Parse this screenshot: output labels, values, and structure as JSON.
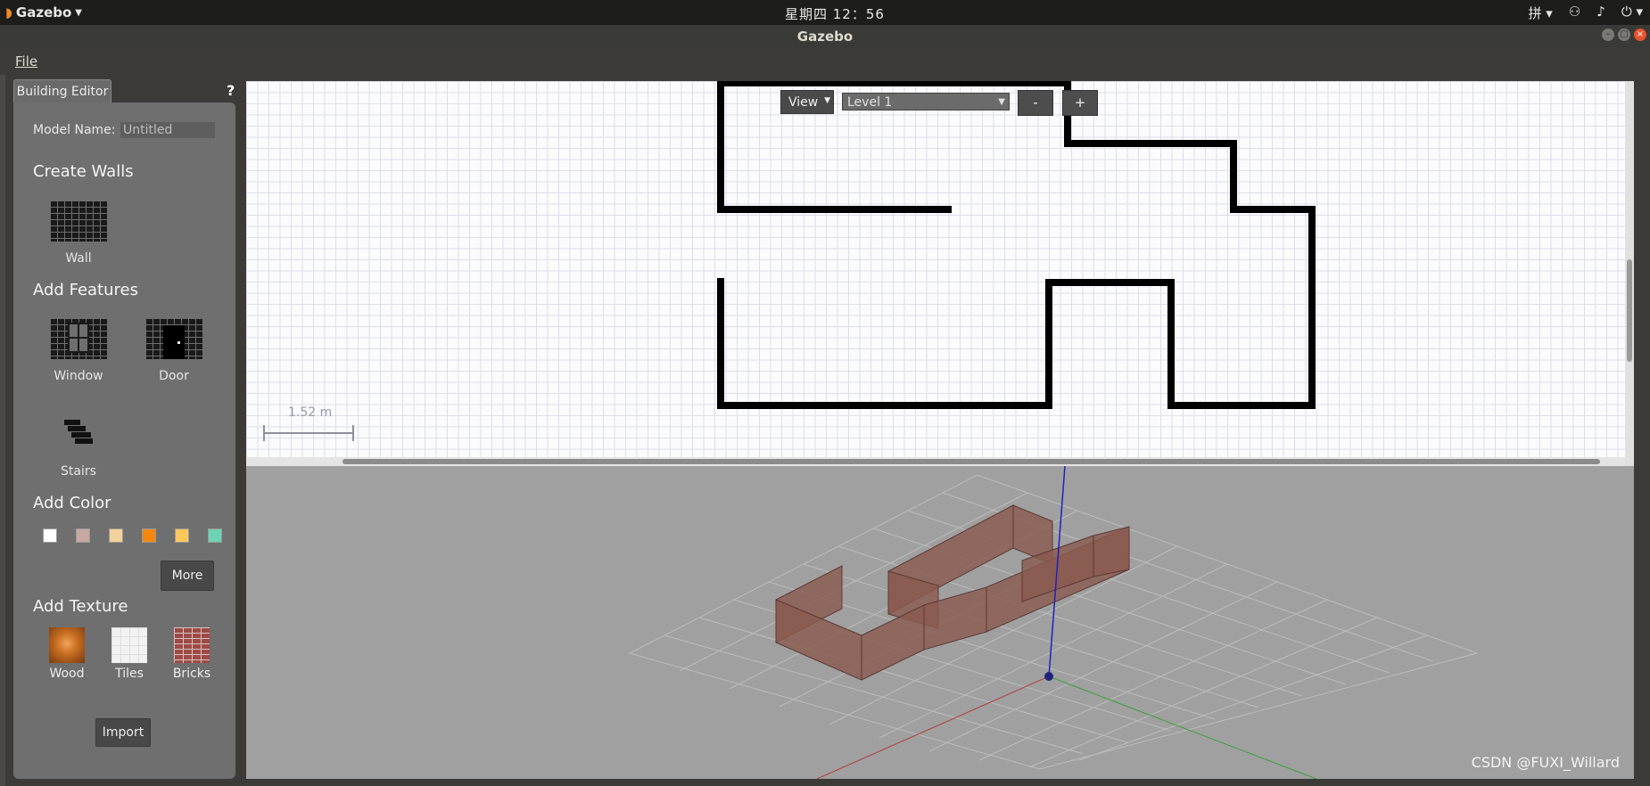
{
  "system_bar": {
    "app_name": "Gazebo",
    "clock": "星期四 12：56",
    "tray_icons": [
      "input-method-icon",
      "network-icon",
      "volume-icon",
      "power-icon"
    ],
    "input_method_label": "拼"
  },
  "window": {
    "title": "Gazebo"
  },
  "menu": {
    "file": "File"
  },
  "building_editor": {
    "tab_label": "Building Editor",
    "help_label": "?",
    "model_name_label": "Model Name:",
    "model_name_value": "Untitled",
    "create_walls_header": "Create Walls",
    "wall_label": "Wall",
    "add_features_header": "Add Features",
    "window_label": "Window",
    "door_label": "Door",
    "stairs_label": "Stairs",
    "add_color_header": "Add Color",
    "colors": [
      "#ffffff",
      "#c8a8a0",
      "#f2d29a",
      "#f5870f",
      "#fdc95c",
      "#6ed2b4"
    ],
    "more_label": "More",
    "add_texture_header": "Add Texture",
    "textures": [
      "Wood",
      "Tiles",
      "Bricks"
    ],
    "import_label": "Import"
  },
  "editor_2d": {
    "view_label": "View",
    "level_label": "Level 1",
    "minus_label": "-",
    "plus_label": "+",
    "scale_label": "1.52 m"
  },
  "watermark": "CSDN @FUXI_Willard"
}
